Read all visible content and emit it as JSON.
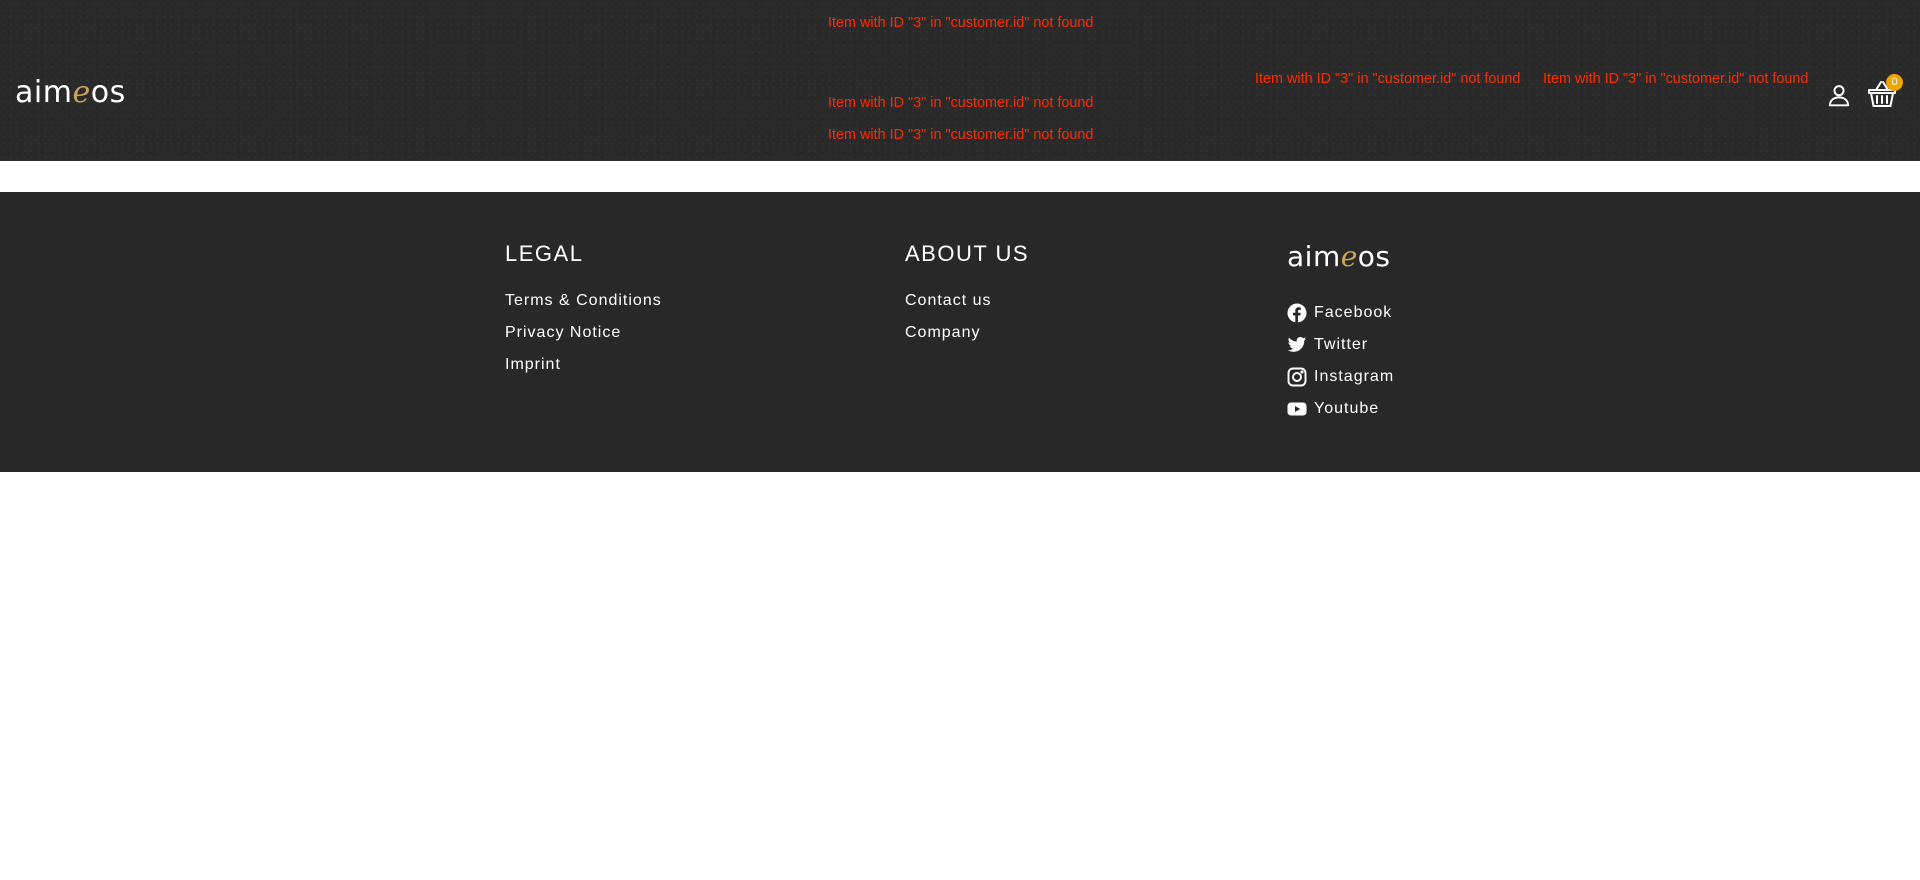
{
  "header": {
    "logo": {
      "pre": "aim",
      "accent": "e",
      "post": "os"
    },
    "errors": [
      "Item with ID \"3\" in \"customer.id\" not found",
      "Item with ID \"3\" in \"customer.id\" not found",
      "Item with ID \"3\" in \"customer.id\" not found",
      "Item with ID \"3\" in \"customer.id\" not found",
      "Item with ID \"3\" in \"customer.id\" not found"
    ],
    "user_icon": "user-icon",
    "cart_icon": "basket-icon",
    "cart_count": "0"
  },
  "footer": {
    "legal": {
      "title": "LEGAL",
      "links": [
        "Terms & Conditions",
        "Privacy Notice",
        "Imprint"
      ]
    },
    "about": {
      "title": "ABOUT US",
      "links": [
        "Contact us",
        "Company"
      ]
    },
    "social": {
      "logo": {
        "pre": "aim",
        "accent": "e",
        "post": "os"
      },
      "links": [
        {
          "label": "Facebook",
          "icon": "facebook-icon"
        },
        {
          "label": "Twitter",
          "icon": "twitter-icon"
        },
        {
          "label": "Instagram",
          "icon": "instagram-icon"
        },
        {
          "label": "Youtube",
          "icon": "youtube-icon"
        }
      ]
    }
  },
  "colors": {
    "header_bg": "#2a2a2a",
    "footer_bg": "#282828",
    "error": "#ff2a00",
    "logo_accent": "#c9a35c",
    "badge": "#f0a400"
  }
}
